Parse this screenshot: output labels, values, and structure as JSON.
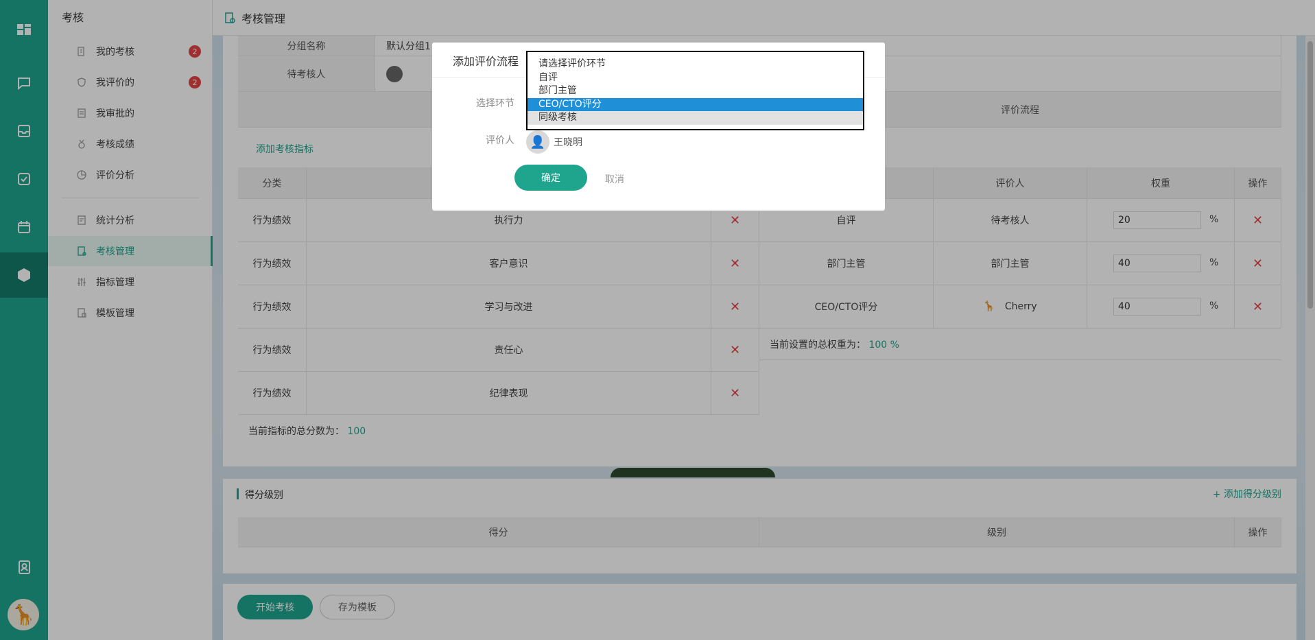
{
  "rail": {
    "icons": [
      "dashboard-icon",
      "chat-icon",
      "inbox-icon",
      "check-icon",
      "calendar-icon",
      "cube-icon",
      "contacts-icon"
    ]
  },
  "nav": {
    "title": "考核",
    "items": [
      {
        "label": "我的考核",
        "badge": "2"
      },
      {
        "label": "我评价的",
        "badge": "2"
      },
      {
        "label": "我审批的",
        "badge": ""
      },
      {
        "label": "考核成绩",
        "badge": ""
      },
      {
        "label": "评价分析",
        "badge": ""
      },
      {
        "label": "统计分析",
        "badge": ""
      },
      {
        "label": "考核管理",
        "badge": ""
      },
      {
        "label": "指标管理",
        "badge": ""
      },
      {
        "label": "模板管理",
        "badge": ""
      }
    ]
  },
  "topbar": {
    "title": "考核管理"
  },
  "form": {
    "group_name_label": "分组名称",
    "group_name_value": "默认分组1",
    "assessee_label": "待考核人",
    "flow_header": "评价流程",
    "add_indicator": "添加考核指标"
  },
  "indicators": {
    "headers": {
      "category": "分类"
    },
    "rows": [
      {
        "category": "行为绩效",
        "name": "执行力"
      },
      {
        "category": "行为绩效",
        "name": "客户意识"
      },
      {
        "category": "行为绩效",
        "name": "学习与改进"
      },
      {
        "category": "行为绩效",
        "name": "责任心"
      },
      {
        "category": "行为绩效",
        "name": "纪律表现"
      }
    ],
    "total_label": "当前指标的总分数为：",
    "total_value": "100"
  },
  "flow": {
    "headers": {
      "evaluator": "评价人",
      "weight": "权重",
      "action": "操作"
    },
    "rows": [
      {
        "step": "自评",
        "evaluator": "待考核人",
        "weight": "20",
        "unit": "%"
      },
      {
        "step": "部门主管",
        "evaluator": "部门主管",
        "weight": "40",
        "unit": "%"
      },
      {
        "step": "CEO/CTO评分",
        "evaluator": "Cherry",
        "weight": "40",
        "unit": "%"
      }
    ],
    "total_label": "当前设置的总权重为：",
    "total_value": "100 %"
  },
  "score_levels": {
    "title": "得分级别",
    "add_label": "添加得分级别",
    "headers": {
      "score": "得分",
      "level": "级别",
      "action": "操作"
    }
  },
  "footer": {
    "start": "开始考核",
    "save_template": "存为模板"
  },
  "dialog": {
    "title": "添加评价流程",
    "step_label": "选择环节",
    "evaluator_label": "评价人",
    "evaluator_name": "王晓明",
    "confirm": "确定",
    "cancel": "取消",
    "options": [
      "请选择评价环节",
      "自评",
      "部门主管",
      "CEO/CTO评分",
      "同级考核"
    ],
    "selected_option": "CEO/CTO评分"
  },
  "colors": {
    "accent": "#1fa58e",
    "danger": "#e64545",
    "select_highlight": "#1f8fd7"
  }
}
